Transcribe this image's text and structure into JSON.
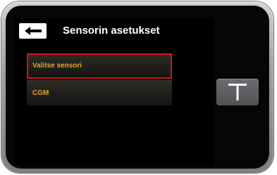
{
  "header": {
    "title": "Sensorin asetukset",
    "back_icon": "arrow-left-icon"
  },
  "menu": {
    "items": [
      {
        "label": "Valitse sensori",
        "selected": true
      },
      {
        "label": "CGM",
        "selected": false
      }
    ]
  },
  "device": {
    "side_button_icon": "t-button-icon"
  },
  "colors": {
    "item_text": "#e9a322",
    "selection_border": "#d4121b",
    "screen_background": "#000000"
  }
}
